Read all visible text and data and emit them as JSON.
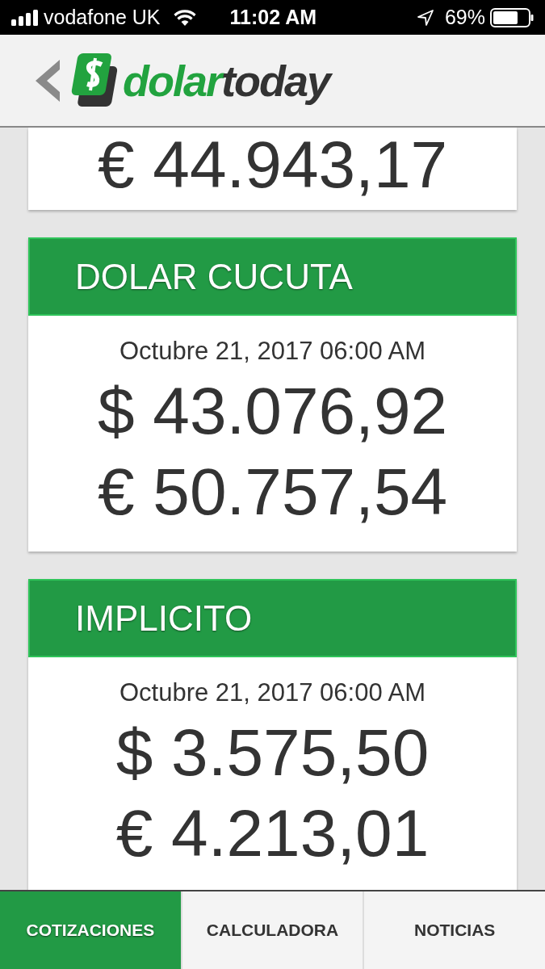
{
  "status_bar": {
    "carrier": "vodafone UK",
    "time": "11:02 AM",
    "battery": "69%"
  },
  "header": {
    "logo_green": "dolar",
    "logo_dark": "today"
  },
  "partial_card": {
    "euro": "€ 44.943,17"
  },
  "cards": [
    {
      "title": "DOLAR CUCUTA",
      "date": "Octubre 21, 2017 06:00 AM",
      "usd": "$ 43.076,92",
      "eur": "€ 50.757,54"
    },
    {
      "title": "IMPLICITO",
      "date": "Octubre 21, 2017 06:00 AM",
      "usd": "$ 3.575,50",
      "eur": "€ 4.213,01"
    }
  ],
  "tabs": [
    {
      "label": "COTIZACIONES",
      "selected": true
    },
    {
      "label": "CALCULADORA",
      "selected": false
    },
    {
      "label": "NOTICIAS",
      "selected": false
    }
  ]
}
